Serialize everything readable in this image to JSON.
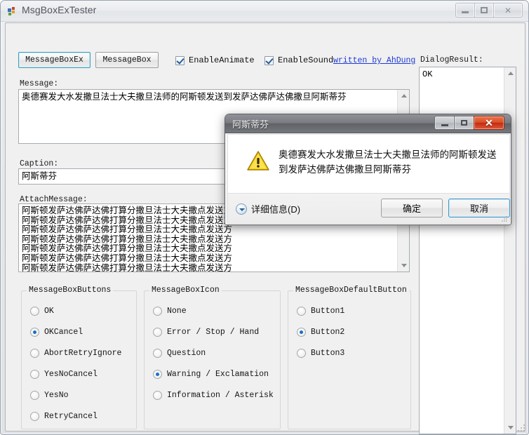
{
  "main_window": {
    "title": "MsgBoxExTester",
    "icon": "app-icon",
    "controls": {
      "minimize": "minimize-icon",
      "maximize": "maximize-icon",
      "close": "close-icon"
    }
  },
  "toolbar": {
    "messageboxex_label": "MessageBoxEx",
    "messagebox_label": "MessageBox",
    "enable_animate_label": "EnableAnimate",
    "enable_animate_checked": true,
    "enable_sound_label": "EnableSound",
    "enable_sound_checked": true,
    "author_link": "written by AhDung"
  },
  "fields": {
    "message_label": "Message:",
    "message_value": "奥德赛发大水发撒旦法士大夫撒旦法师的阿斯顿发送到发萨达佛萨达佛撒旦阿斯蒂芬",
    "caption_label": "Caption:",
    "caption_value": "阿斯蒂芬",
    "attach_label": "AttachMessage:",
    "attach_value": "阿斯顿发萨达佛萨达佛打算分撒旦法士大夫撒点发送方\n阿斯顿发萨达佛萨达佛打算分撒旦法士大夫撒点发送方\n阿斯顿发萨达佛萨达佛打算分撒旦法士大夫撒点发送方\n阿斯顿发萨达佛萨达佛打算分撒旦法士大夫撒点发送方\n阿斯顿发萨达佛萨达佛打算分撒旦法士大夫撒点发送方\n阿斯顿发萨达佛萨达佛打算分撒旦法士大夫撒点发送方\n阿斯顿发萨达佛萨达佛打算分撒旦法士大夫撒点发送方",
    "dialogresult_label": "DialogResult:",
    "dialogresult_value": "OK"
  },
  "groups": {
    "buttons": {
      "title": "MessageBoxButtons",
      "options": [
        {
          "label": "OK",
          "selected": false
        },
        {
          "label": "OKCancel",
          "selected": true
        },
        {
          "label": "AbortRetryIgnore",
          "selected": false
        },
        {
          "label": "YesNoCancel",
          "selected": false
        },
        {
          "label": "YesNo",
          "selected": false
        },
        {
          "label": "RetryCancel",
          "selected": false
        }
      ]
    },
    "icon": {
      "title": "MessageBoxIcon",
      "options": [
        {
          "label": "None",
          "selected": false
        },
        {
          "label": "Error / Stop / Hand",
          "selected": false
        },
        {
          "label": "Question",
          "selected": false
        },
        {
          "label": "Warning / Exclamation",
          "selected": true
        },
        {
          "label": "Information / Asterisk",
          "selected": false
        }
      ]
    },
    "defaultbutton": {
      "title": "MessageBoxDefaultButton",
      "options": [
        {
          "label": "Button1",
          "selected": false
        },
        {
          "label": "Button2",
          "selected": true
        },
        {
          "label": "Button3",
          "selected": false
        }
      ]
    }
  },
  "dialog": {
    "title": "阿斯蒂芬",
    "message": "奥德赛发大水发撒旦法士大夫撒旦法师的阿斯顿发送到发萨达佛萨达佛撒旦阿斯蒂芬",
    "icon": "warning-icon",
    "expand_label": "详细信息(D)",
    "ok_label": "确定",
    "cancel_label": "取消",
    "controls": {
      "minimize": "minimize-icon",
      "maximize": "maximize-icon",
      "close": "close-icon"
    }
  },
  "colors": {
    "link": "#1d3ad4",
    "focus_border": "#3d94cc",
    "radio_dot": "#1c6fc4",
    "close_button_red": "#c22b10",
    "warning_yellow": "#ffcc22"
  }
}
